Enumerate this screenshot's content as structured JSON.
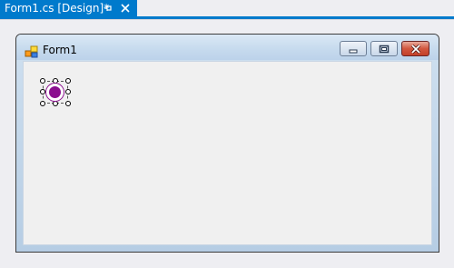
{
  "document_tab": {
    "label": "Form1.cs [Design]*",
    "pin_icon": "pin-icon",
    "close_icon": "close-icon"
  },
  "form": {
    "title": "Form1",
    "app_icon": "form-app-icon",
    "buttons": {
      "minimize": "minimize-icon",
      "maximize": "maximize-icon",
      "close": "close-icon"
    }
  },
  "selected_control": {
    "type": "radio-button",
    "checked": true
  },
  "colors": {
    "accent": "#007acc",
    "radio_fill": "#8b0f8f",
    "close_button": "#c3402a"
  }
}
